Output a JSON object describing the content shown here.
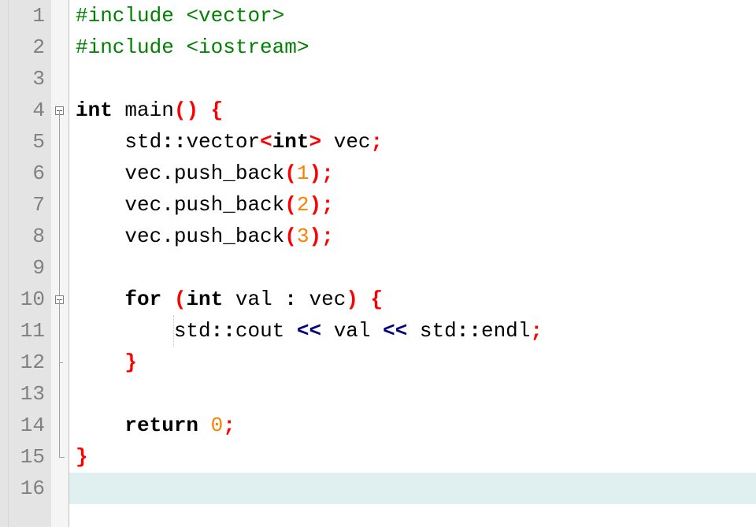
{
  "editor": {
    "font": "Consolas",
    "line_height": 40,
    "current_line": 16,
    "total_lines": 16,
    "gutter": [
      "1",
      "2",
      "3",
      "4",
      "5",
      "6",
      "7",
      "8",
      "9",
      "10",
      "11",
      "12",
      "13",
      "14",
      "15",
      "16"
    ],
    "fold_points": [
      4,
      10
    ],
    "fold_ends": [
      12,
      15
    ],
    "lines": {
      "1": [
        {
          "t": "#include ",
          "c": "pp"
        },
        {
          "t": "<vector>",
          "c": "pp"
        }
      ],
      "2": [
        {
          "t": "#include ",
          "c": "pp"
        },
        {
          "t": "<iostream>",
          "c": "pp"
        }
      ],
      "3": [],
      "4": [
        {
          "t": "int",
          "c": "kw"
        },
        {
          "t": " ",
          "c": "id"
        },
        {
          "t": "main",
          "c": "id"
        },
        {
          "t": "()",
          "c": "par"
        },
        {
          "t": " ",
          "c": "id"
        },
        {
          "t": "{",
          "c": "brc"
        }
      ],
      "5": [
        {
          "t": "    ",
          "c": "id"
        },
        {
          "t": "std",
          "c": "id"
        },
        {
          "t": "::",
          "c": "col"
        },
        {
          "t": "vector",
          "c": "id"
        },
        {
          "t": "<",
          "c": "ang"
        },
        {
          "t": "int",
          "c": "kw"
        },
        {
          "t": ">",
          "c": "ang"
        },
        {
          "t": " vec",
          "c": "id"
        },
        {
          "t": ";",
          "c": "semi"
        }
      ],
      "6": [
        {
          "t": "    vec",
          "c": "id"
        },
        {
          "t": ".",
          "c": "dot"
        },
        {
          "t": "push_back",
          "c": "fn"
        },
        {
          "t": "(",
          "c": "par"
        },
        {
          "t": "1",
          "c": "num"
        },
        {
          "t": ")",
          "c": "par"
        },
        {
          "t": ";",
          "c": "semi"
        }
      ],
      "7": [
        {
          "t": "    vec",
          "c": "id"
        },
        {
          "t": ".",
          "c": "dot"
        },
        {
          "t": "push_back",
          "c": "fn"
        },
        {
          "t": "(",
          "c": "par"
        },
        {
          "t": "2",
          "c": "num"
        },
        {
          "t": ")",
          "c": "par"
        },
        {
          "t": ";",
          "c": "semi"
        }
      ],
      "8": [
        {
          "t": "    vec",
          "c": "id"
        },
        {
          "t": ".",
          "c": "dot"
        },
        {
          "t": "push_back",
          "c": "fn"
        },
        {
          "t": "(",
          "c": "par"
        },
        {
          "t": "3",
          "c": "num"
        },
        {
          "t": ")",
          "c": "par"
        },
        {
          "t": ";",
          "c": "semi"
        }
      ],
      "9": [],
      "10": [
        {
          "t": "    ",
          "c": "id"
        },
        {
          "t": "for",
          "c": "kw"
        },
        {
          "t": " ",
          "c": "id"
        },
        {
          "t": "(",
          "c": "par"
        },
        {
          "t": "int",
          "c": "kw"
        },
        {
          "t": " val ",
          "c": "id"
        },
        {
          "t": ":",
          "c": "col"
        },
        {
          "t": " vec",
          "c": "id"
        },
        {
          "t": ")",
          "c": "par"
        },
        {
          "t": " ",
          "c": "id"
        },
        {
          "t": "{",
          "c": "brc"
        }
      ],
      "11": [
        {
          "t": "        std",
          "c": "id"
        },
        {
          "t": "::",
          "c": "col"
        },
        {
          "t": "cout ",
          "c": "id"
        },
        {
          "t": "<<",
          "c": "op"
        },
        {
          "t": " val ",
          "c": "id"
        },
        {
          "t": "<<",
          "c": "op"
        },
        {
          "t": " std",
          "c": "id"
        },
        {
          "t": "::",
          "c": "col"
        },
        {
          "t": "endl",
          "c": "id"
        },
        {
          "t": ";",
          "c": "semi"
        }
      ],
      "12": [
        {
          "t": "    ",
          "c": "id"
        },
        {
          "t": "}",
          "c": "brc"
        }
      ],
      "13": [],
      "14": [
        {
          "t": "    ",
          "c": "id"
        },
        {
          "t": "return",
          "c": "kw"
        },
        {
          "t": " ",
          "c": "id"
        },
        {
          "t": "0",
          "c": "num"
        },
        {
          "t": ";",
          "c": "semi"
        }
      ],
      "15": [
        {
          "t": "}",
          "c": "brc"
        }
      ],
      "16": []
    }
  }
}
